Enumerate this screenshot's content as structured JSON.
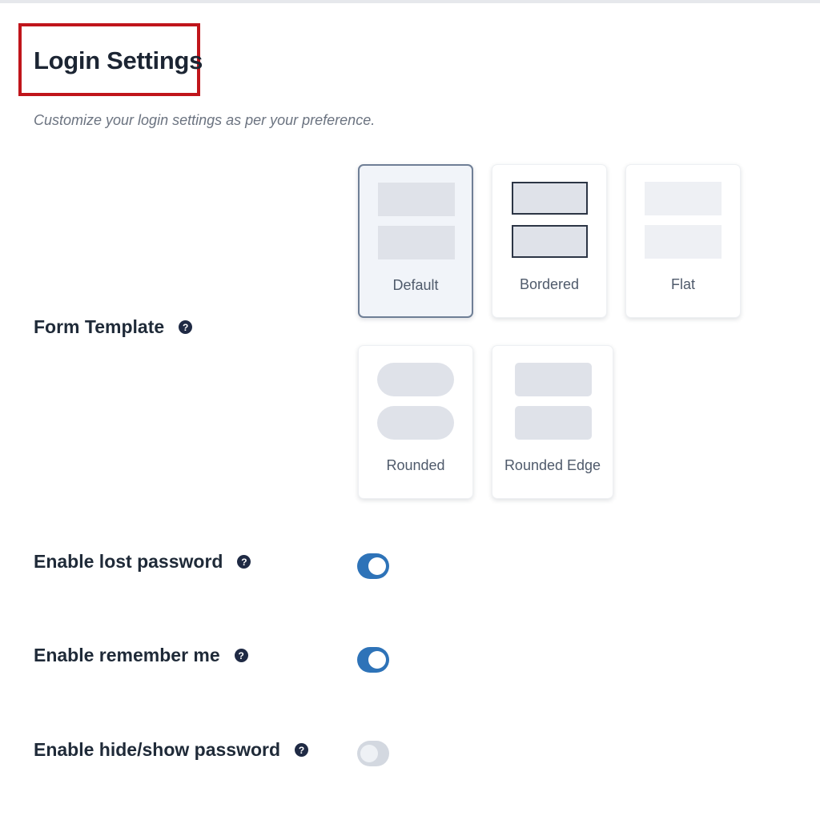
{
  "header": {
    "title": "Login Settings",
    "subtitle": "Customize your login settings as per your preference."
  },
  "form_template": {
    "label": "Form Template",
    "help_icon": "question-circle-icon",
    "selected": "Default",
    "options": [
      {
        "label": "Default"
      },
      {
        "label": "Bordered"
      },
      {
        "label": "Flat"
      },
      {
        "label": "Rounded"
      },
      {
        "label": "Rounded Edge"
      }
    ]
  },
  "settings": [
    {
      "label": "Enable lost password",
      "enabled": true
    },
    {
      "label": "Enable remember me",
      "enabled": true
    },
    {
      "label": "Enable hide/show password",
      "enabled": false
    }
  ],
  "colors": {
    "toggle_on": "#2e73b8",
    "toggle_off": "#d3d8e0",
    "highlight_box": "#c0151b"
  }
}
